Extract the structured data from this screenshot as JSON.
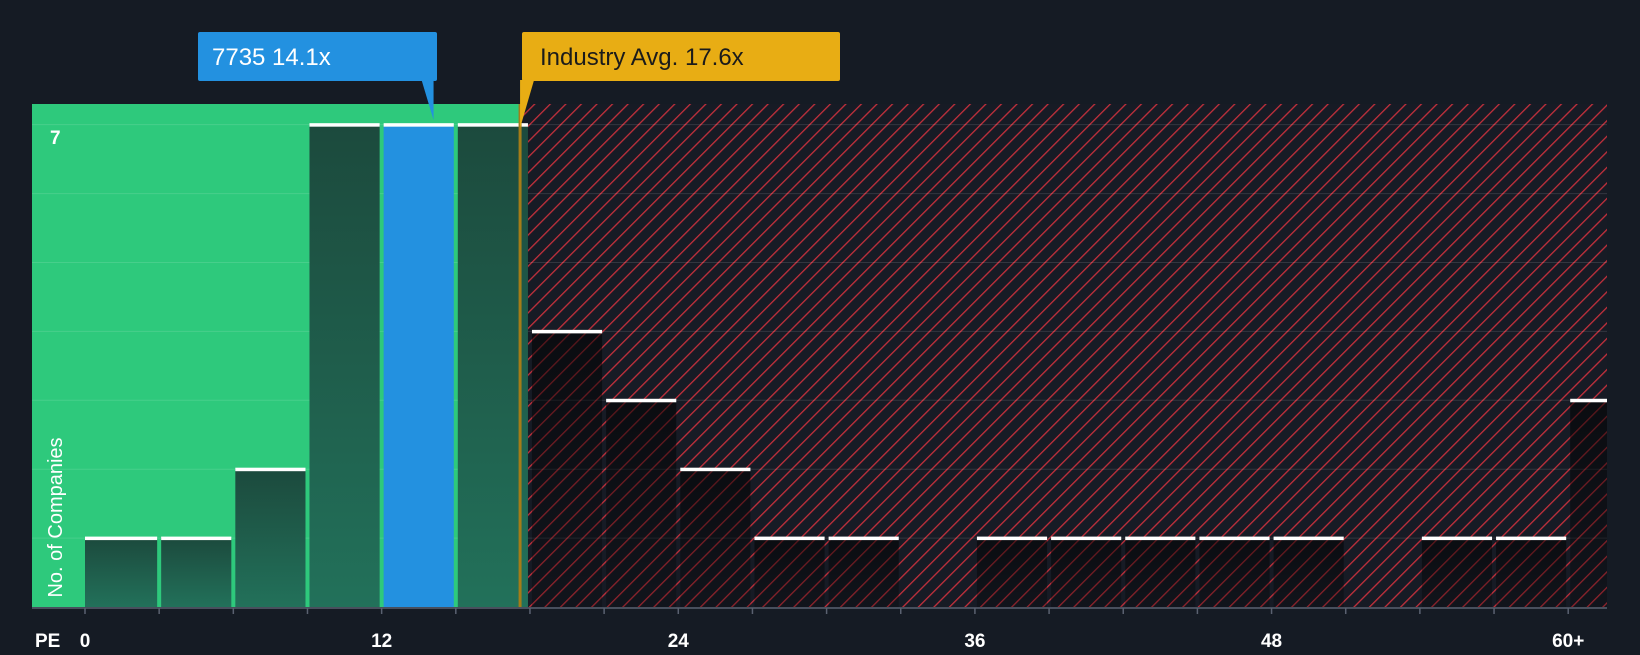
{
  "chart_data": {
    "type": "bar",
    "xlabel": "PE",
    "ylabel": "No. of Companies",
    "x_ticks": [
      "0",
      "12",
      "24",
      "36",
      "48",
      "60+"
    ],
    "x_tick_values": [
      0,
      12,
      24,
      36,
      48,
      60
    ],
    "y_ticks": [
      "7"
    ],
    "y_tick_values": [
      7
    ],
    "ylim": [
      0,
      7.3
    ],
    "bin_width": 3,
    "bins": [
      {
        "start": 0,
        "count": 1
      },
      {
        "start": 3,
        "count": 1
      },
      {
        "start": 6,
        "count": 2
      },
      {
        "start": 9,
        "count": 7
      },
      {
        "start": 12,
        "count": 7
      },
      {
        "start": 15,
        "count": 7
      },
      {
        "start": 18,
        "count": 4
      },
      {
        "start": 21,
        "count": 3
      },
      {
        "start": 24,
        "count": 2
      },
      {
        "start": 27,
        "count": 1
      },
      {
        "start": 30,
        "count": 1
      },
      {
        "start": 33,
        "count": 0
      },
      {
        "start": 36,
        "count": 1
      },
      {
        "start": 39,
        "count": 1
      },
      {
        "start": 42,
        "count": 1
      },
      {
        "start": 45,
        "count": 1
      },
      {
        "start": 48,
        "count": 1
      },
      {
        "start": 51,
        "count": 0
      },
      {
        "start": 54,
        "count": 1
      },
      {
        "start": 57,
        "count": 1
      },
      {
        "start": 60,
        "count": 3
      }
    ],
    "company": {
      "ticker": "7735",
      "pe": 14.1,
      "label": "7735 14.1x"
    },
    "industry_avg": {
      "pe": 17.6,
      "label": "Industry Avg. 17.6x"
    },
    "grid": true,
    "colors": {
      "background": "#151b24",
      "undervalued_zone": "#2ec97c",
      "overvalued_zone": "#c4303c",
      "bar_dark": "#1d4a3c",
      "company_bar": "#2391e0",
      "company_callout": "#2391e0",
      "industry_callout": "#e8ad14",
      "industry_line": "#a57c18",
      "bar_top": "#ffffff"
    }
  }
}
